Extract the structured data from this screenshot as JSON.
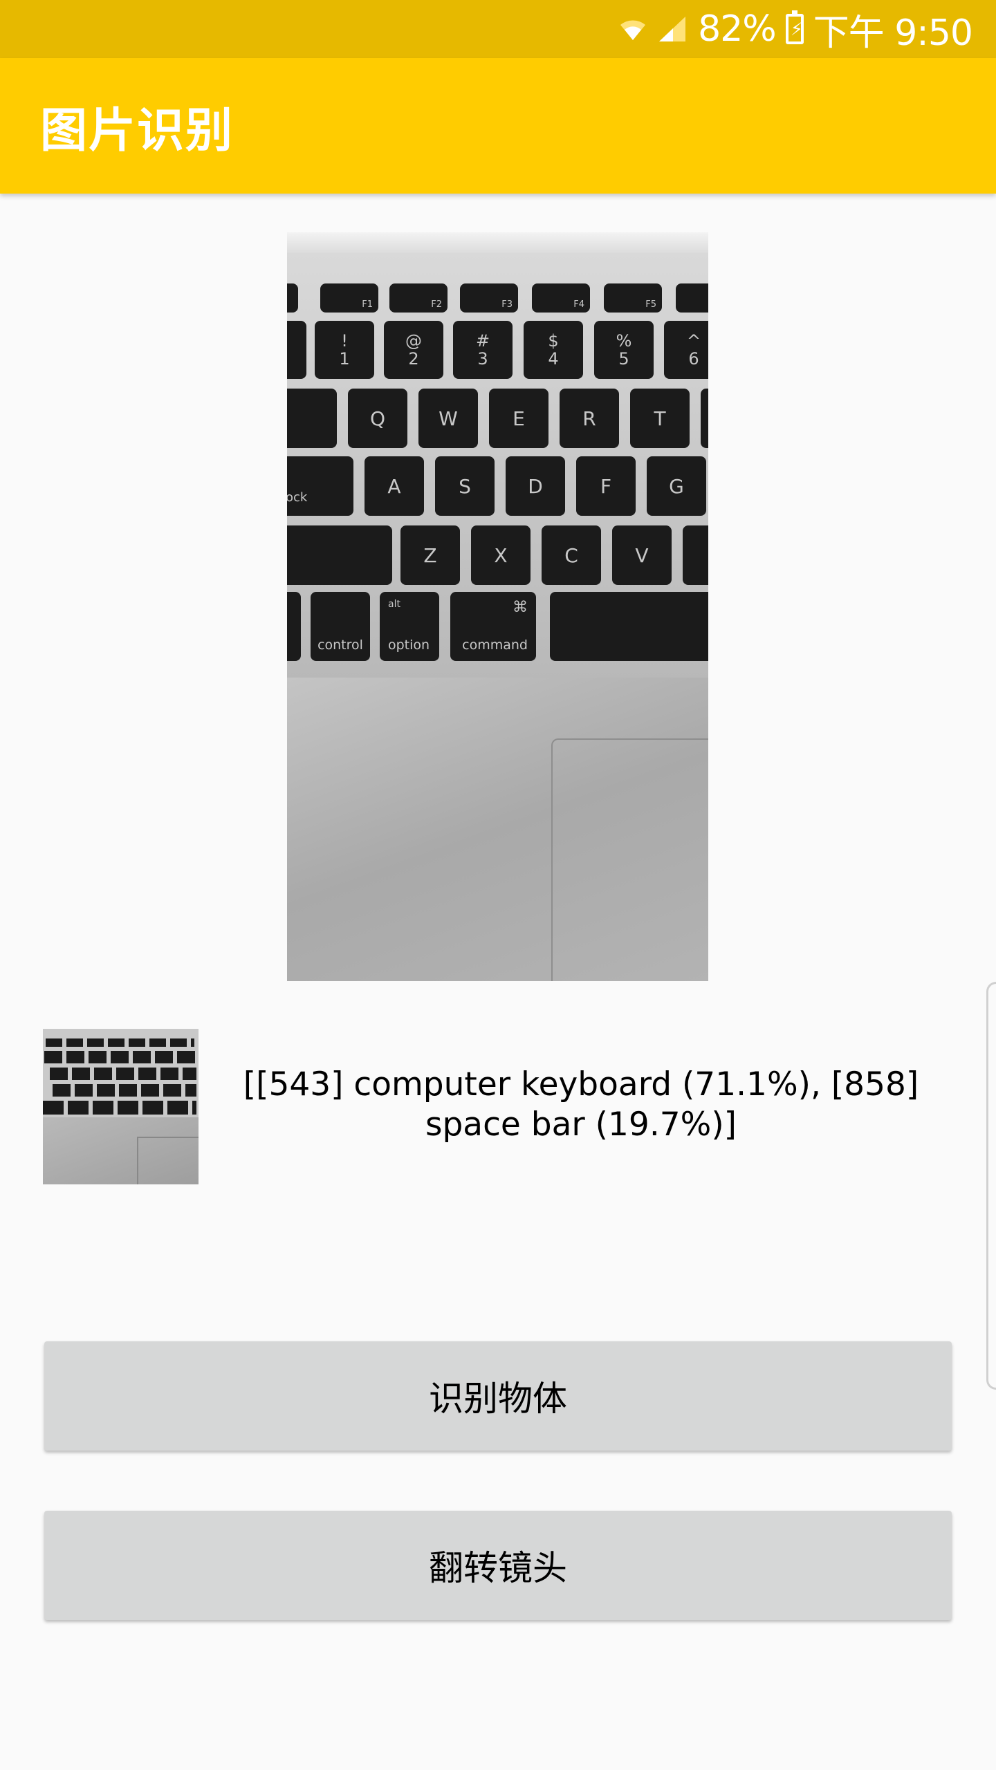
{
  "status_bar": {
    "wifi_icon": "wifi-icon",
    "signal_icon": "signal-icon",
    "battery_percent": "82%",
    "battery_icon": "battery-charging-icon",
    "time": "下午 9:50"
  },
  "toolbar": {
    "title": "图片识别"
  },
  "preview": {
    "image": "keyboard-photo",
    "keys_row1": [
      "F1",
      "F2",
      "F3",
      "F4",
      "F5"
    ],
    "keys_row2": [
      [
        "!",
        "1"
      ],
      [
        "@",
        "2"
      ],
      [
        "#",
        "3"
      ],
      [
        "$",
        "4"
      ],
      [
        "%",
        "5"
      ],
      [
        "^",
        "6"
      ]
    ],
    "keys_row3": [
      "Q",
      "W",
      "E",
      "R",
      "T"
    ],
    "keys_row4": [
      "ock",
      "A",
      "S",
      "D",
      "F",
      "G"
    ],
    "keys_row5": [
      "Z",
      "X",
      "C",
      "V"
    ],
    "keys_row6": [
      "control",
      "alt",
      "option",
      "⌘",
      "command"
    ]
  },
  "result": {
    "text": "[[543] computer keyboard (71.1%), [858] space bar (19.7%)]"
  },
  "buttons": {
    "recognize": "识别物体",
    "flip": "翻转镜头"
  },
  "colors": {
    "status_bar": "#e6b900",
    "toolbar": "#ffcc00",
    "button": "#d6d7d7",
    "background": "#fafafa"
  }
}
